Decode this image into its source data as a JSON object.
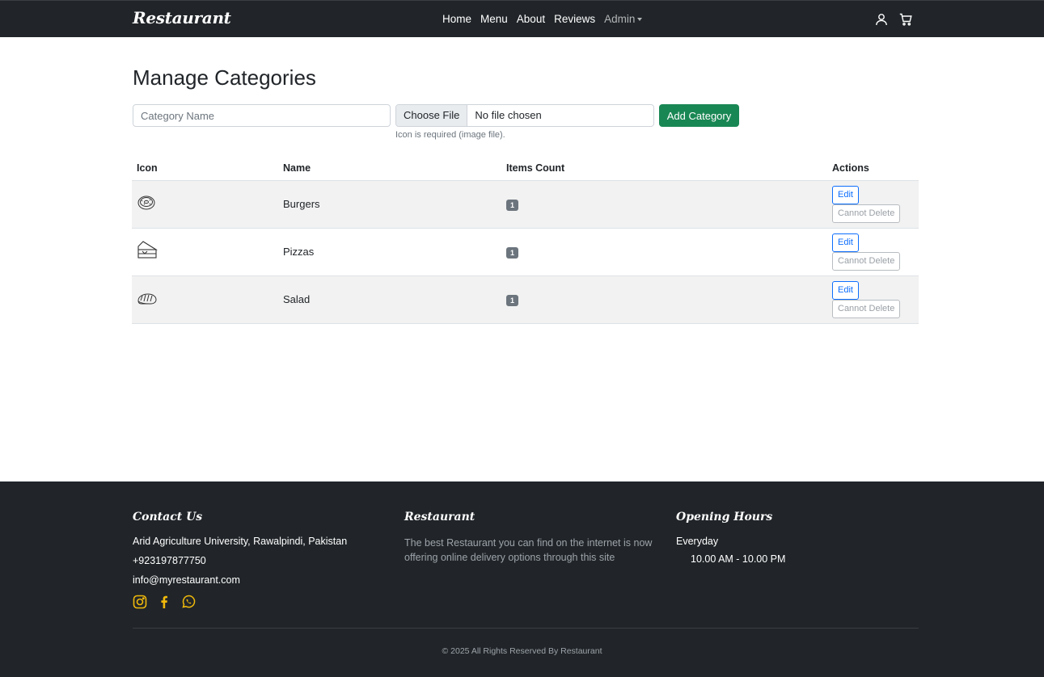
{
  "navbar": {
    "brand": "Restaurant",
    "links": [
      "Home",
      "Menu",
      "About",
      "Reviews"
    ],
    "admin_label": "Admin"
  },
  "main": {
    "title": "Manage Categories",
    "category_placeholder": "Category Name",
    "file_button": "Choose File",
    "file_status": "No file chosen",
    "help_text": "Icon is required (image file).",
    "add_button": "Add Category",
    "table": {
      "headers": [
        "Icon",
        "Name",
        "Items Count",
        "Actions"
      ],
      "rows": [
        {
          "icon": "donut-icon",
          "name": "Burgers",
          "count": "1"
        },
        {
          "icon": "cake-slice-icon",
          "name": "Pizzas",
          "count": "1"
        },
        {
          "icon": "bread-icon",
          "name": "Salad",
          "count": "1"
        }
      ],
      "edit_label": "Edit",
      "delete_label": "Cannot Delete"
    }
  },
  "footer": {
    "contact_title": "Contact Us",
    "address": "Arid Agriculture University, Rawalpindi, Pakistan",
    "phone": "+923197877750",
    "email": "info@myrestaurant.com",
    "about_title": "Restaurant",
    "about_text": "The best Restaurant you can find on the internet is now offering online delivery options through this site",
    "hours_title": "Opening Hours",
    "hours_day": "Everyday",
    "hours_time": "10.00 AM - 10.00 PM",
    "copyright": "© 2025 All Rights Reserved By Restaurant"
  },
  "colors": {
    "dark": "#212529",
    "success": "#198754",
    "primary": "#0d6efd",
    "social": "#f0b90b"
  }
}
